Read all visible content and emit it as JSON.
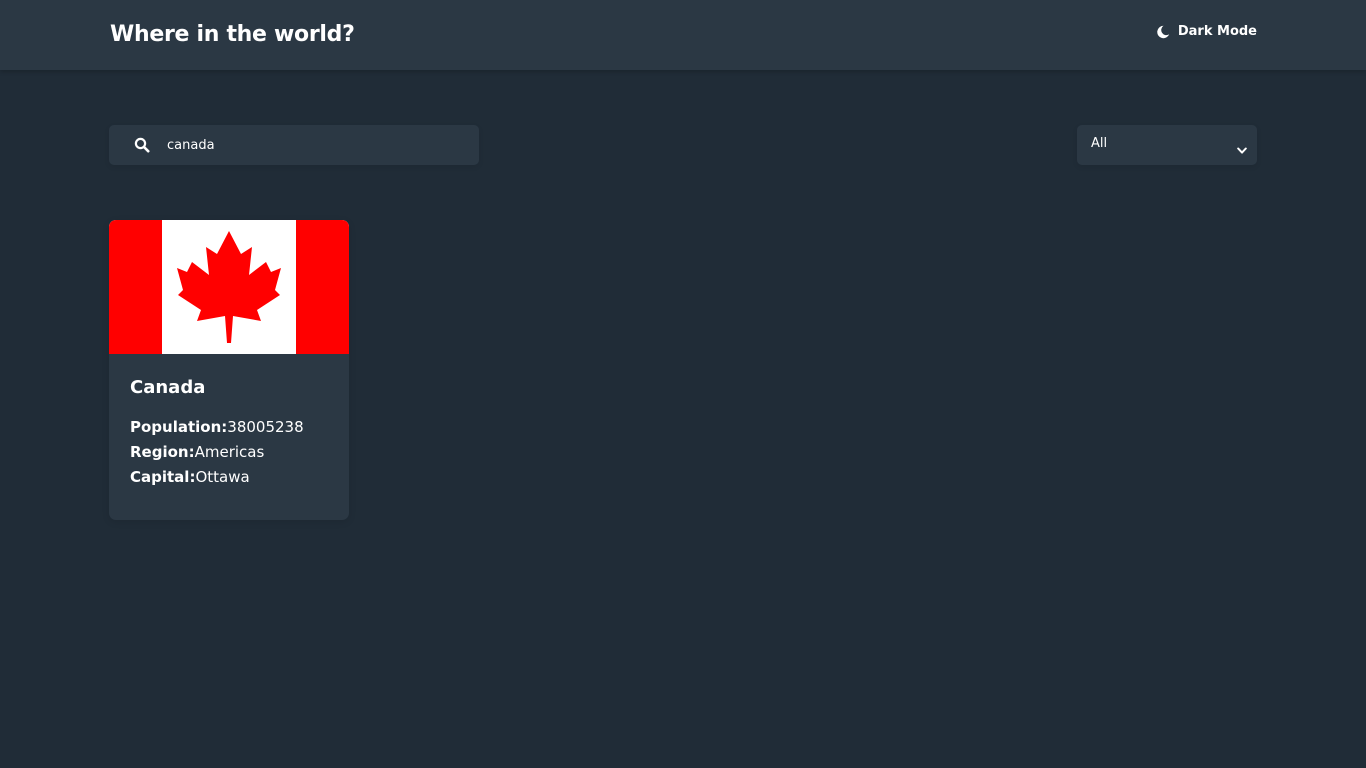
{
  "header": {
    "title": "Where in the world?",
    "theme_toggle_label": "Dark Mode",
    "theme_icon": "moon-icon"
  },
  "search": {
    "value": "canada",
    "icon": "search-icon"
  },
  "filter": {
    "selected": "All",
    "icon": "chevron-down-icon"
  },
  "countries": [
    {
      "name": "Canada",
      "flag_icon": "canada-flag",
      "population_label": "Population:",
      "population": "38005238",
      "region_label": "Region:",
      "region": "Americas",
      "capital_label": "Capital:",
      "capital": "Ottawa"
    }
  ],
  "colors": {
    "background": "#202c37",
    "surface": "#2b3844",
    "text": "#ffffff",
    "flag_red": "#ff0000"
  }
}
